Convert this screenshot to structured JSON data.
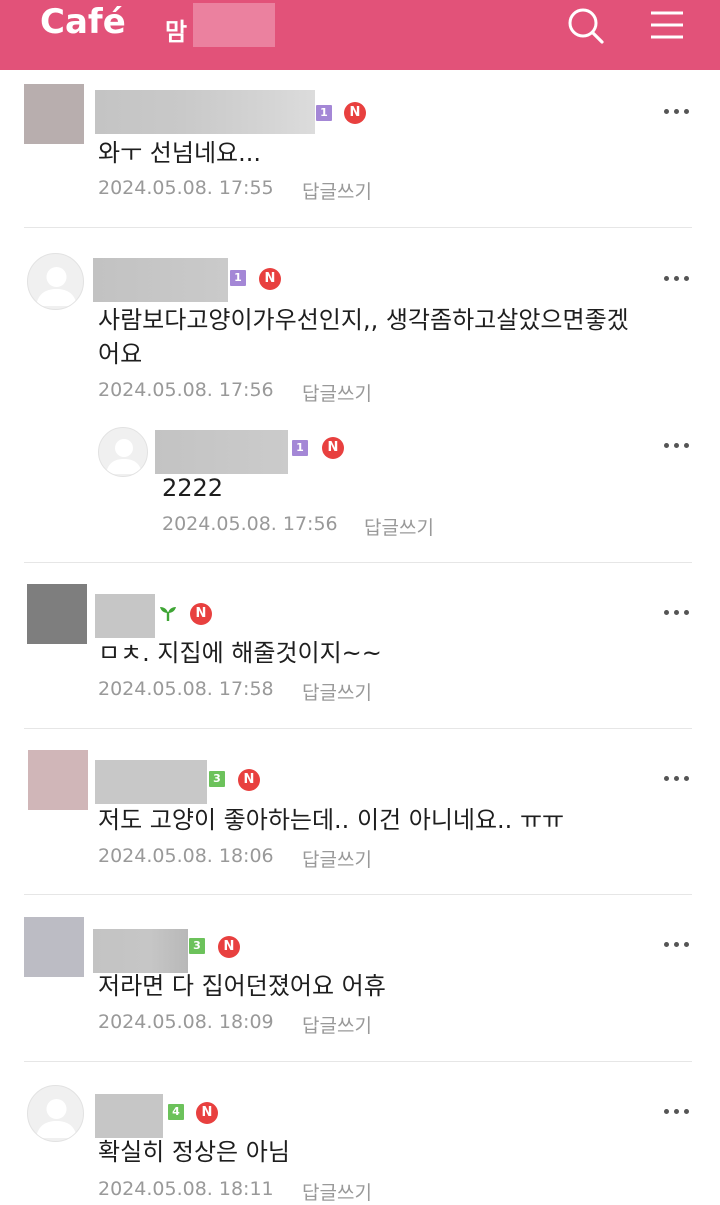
{
  "header": {
    "logo": "Café",
    "cafe_name": "맘",
    "accent_color": "#e25279",
    "icons": [
      "search-icon",
      "menu-icon"
    ]
  },
  "comments": [
    {
      "level": "1",
      "text": "와ㅜ 선넘네요...",
      "date": "2024.05.08. 17:55",
      "reply_label": "답글쓰기"
    },
    {
      "level": "1",
      "text_line1": "사람보다고양이가우선인지,, 생각좀하고살았으면좋겠",
      "text_line2": "어요",
      "date": "2024.05.08. 17:56",
      "reply_label": "답글쓰기"
    },
    {
      "level": "1",
      "text": "2222",
      "date": "2024.05.08. 17:56",
      "reply_label": "답글쓰기",
      "is_reply": true
    },
    {
      "level": "sprout",
      "text": "ㅁㅊ. 지집에 해줄것이지~~",
      "date": "2024.05.08. 17:58",
      "reply_label": "답글쓰기"
    },
    {
      "level": "3",
      "text": "저도 고양이 좋아하는데.. 이건 아니네요.. ㅠㅠ",
      "date": "2024.05.08. 18:06",
      "reply_label": "답글쓰기"
    },
    {
      "level": "3",
      "text": "저라면 다 집어던졌어요 어휴",
      "date": "2024.05.08. 18:09",
      "reply_label": "답글쓰기"
    },
    {
      "level": "4",
      "text": "확실히 정상은 아님",
      "date": "2024.05.08. 18:11",
      "reply_label": "답글쓰기"
    }
  ],
  "badge_new": "N"
}
